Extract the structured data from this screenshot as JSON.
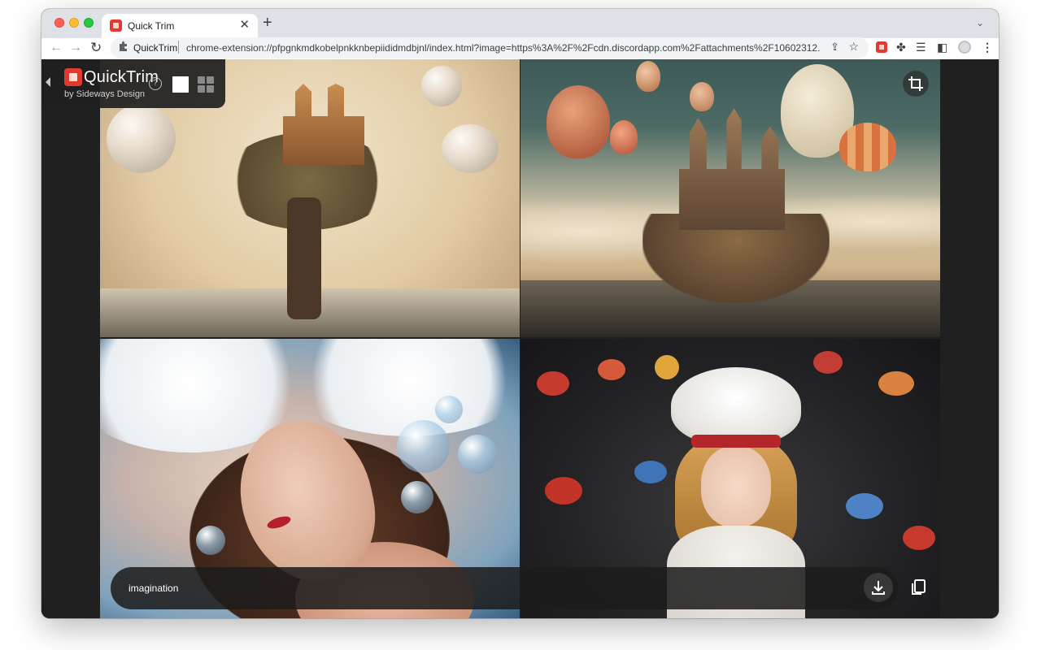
{
  "browser": {
    "tab_title": "Quick Trim",
    "tab_close": "✕",
    "new_tab": "+",
    "tabs_menu": "⌄",
    "site_label": "QuickTrim",
    "url": "chrome-extension://pfpgnkmdkobelpnkknbepiididmdbjnl/index.html?image=https%3A%2F%2Fcdn.discordapp.com%2Fattachments%2F10602312...",
    "icons": {
      "back": "←",
      "forward": "→",
      "reload": "↻",
      "share": "⇪",
      "star": "☆",
      "puzzle": "✤",
      "media": "☰",
      "sidepanel": "◧",
      "menu": "⋮"
    }
  },
  "app": {
    "name": "QuickTrim",
    "subtitle": "by Sideways Design",
    "help_label": "?",
    "view_modes": [
      "single",
      "grid"
    ],
    "active_view": "single"
  },
  "gallery": {
    "images": [
      {
        "name": "floating-tree-castle"
      },
      {
        "name": "balloon-island-castle"
      },
      {
        "name": "woman-in-clouds-with-bubbles"
      },
      {
        "name": "girl-in-white-hat-with-birds"
      }
    ]
  },
  "prompt_bar": {
    "text": "imagination"
  },
  "colors": {
    "brand": "#e23a2e",
    "panel": "#202020",
    "chrome_tabstrip": "#dee1e6"
  }
}
